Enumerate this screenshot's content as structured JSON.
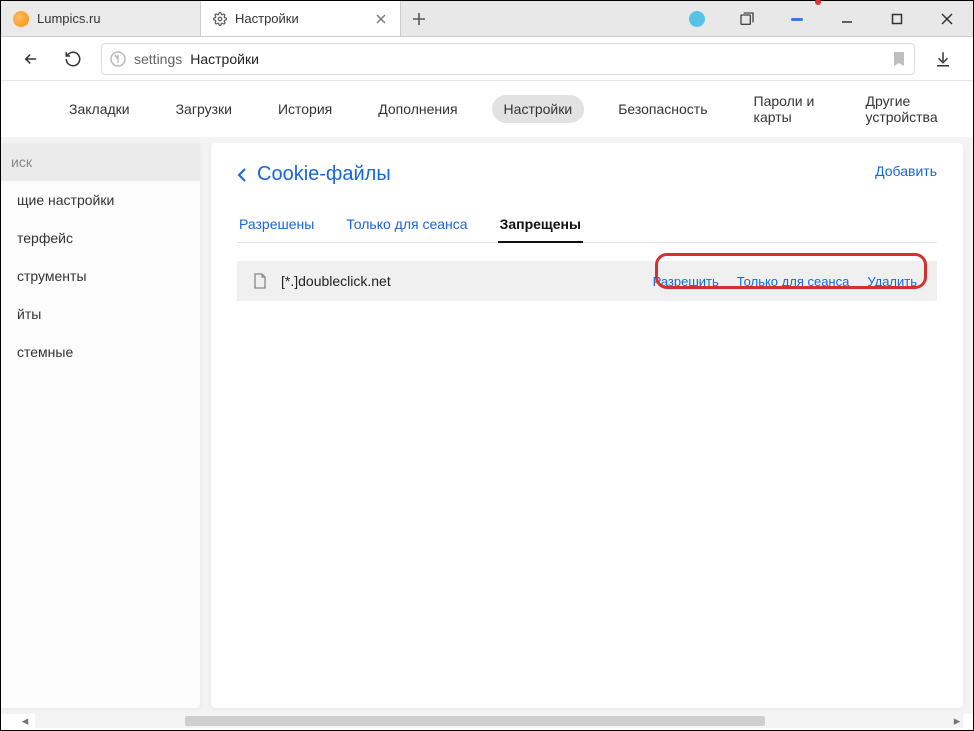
{
  "tabs": [
    {
      "title": "Lumpics.ru",
      "icon": "orange-circle"
    },
    {
      "title": "Настройки",
      "icon": "gear"
    }
  ],
  "addressbar": {
    "prefix": "settings",
    "title": "Настройки"
  },
  "topmenu": {
    "items": [
      "Закладки",
      "Загрузки",
      "История",
      "Дополнения",
      "Настройки",
      "Безопасность",
      "Пароли и карты",
      "Другие устройства"
    ],
    "active_index": 4
  },
  "sidebar": {
    "search_placeholder": "иск",
    "items": [
      "щие настройки",
      "терфейс",
      "струменты",
      "йты",
      "стемные"
    ]
  },
  "main": {
    "heading": "Cookie-файлы",
    "add_label": "Добавить",
    "subtabs": [
      "Разрешены",
      "Только для сеанса",
      "Запрещены"
    ],
    "subtab_active_index": 2,
    "row": {
      "domain": "[*.]doubleclick.net",
      "actions": [
        "Разрешить",
        "Только для сеанса",
        "Удалить"
      ]
    }
  }
}
